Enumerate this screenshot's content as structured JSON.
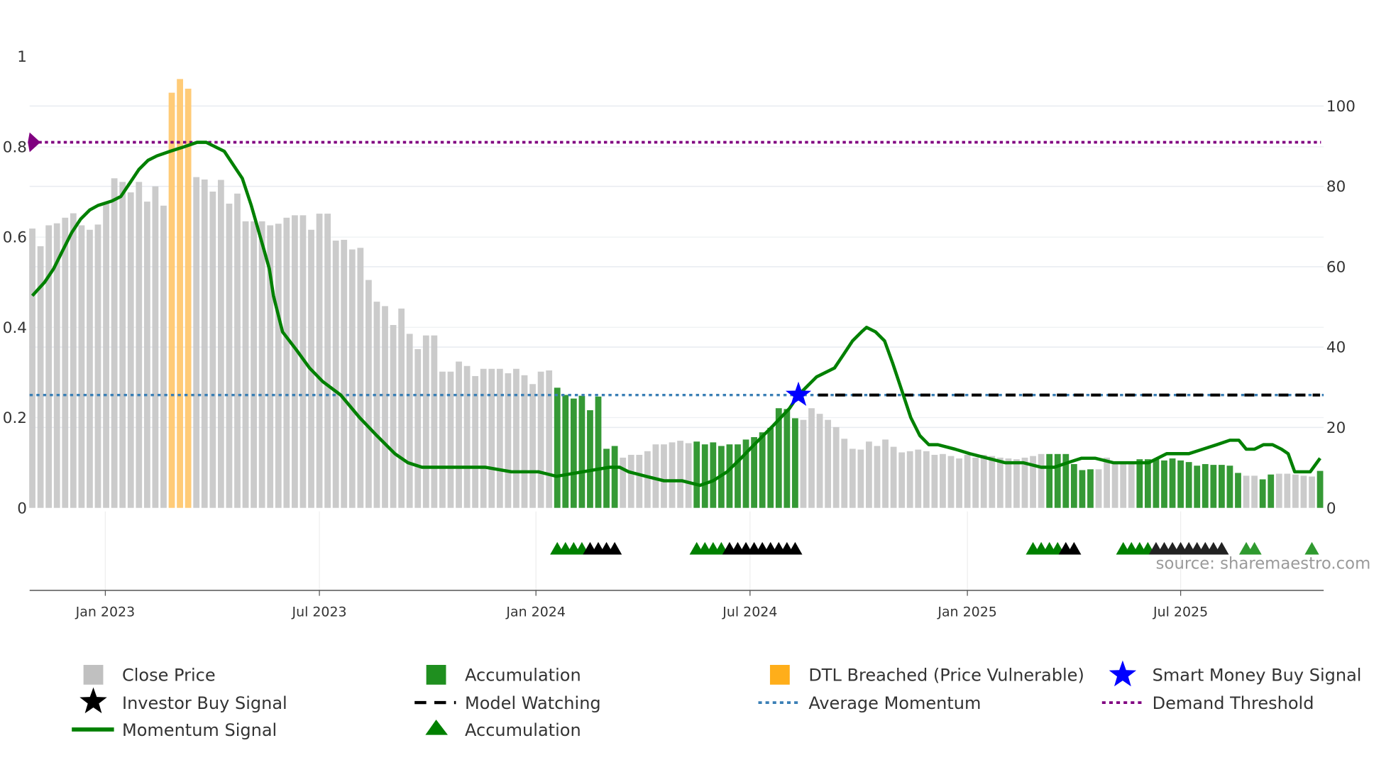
{
  "colors": {
    "close_price": "#c8c8c8",
    "accumulation": "#2a932a",
    "dtl_breached": "#ffc870",
    "dtl_legend": "#ffae1a",
    "momentum": "#008000",
    "average_momentum": "#3a7fb5",
    "demand_threshold": "#800080",
    "model_watching": "#000000",
    "smart_money": "#0000ff",
    "investor_buy": "#000000"
  },
  "source": "source: sharemaestro.com",
  "chart_data": {
    "type": "bar",
    "title": "",
    "xlabel": "",
    "ylabel_left": "",
    "ylabel_right": "",
    "x_unit": "week index",
    "ylim_left": [
      0,
      1
    ],
    "ylim_right": [
      0,
      112.3
    ],
    "left_ticks": [
      "0",
      "0.2",
      "0.4",
      "0.6",
      "0.8",
      "1"
    ],
    "left_tick_values": [
      0,
      0.2,
      0.4,
      0.6,
      0.8,
      1
    ],
    "right_ticks": [
      "0",
      "20",
      "40",
      "60",
      "80",
      "100"
    ],
    "right_tick_values": [
      0,
      20,
      40,
      60,
      80,
      100
    ],
    "x_ticks": [
      {
        "label": "Jan 2023",
        "x": 8.9
      },
      {
        "label": "Jul 2023",
        "x": 35.0
      },
      {
        "label": "Jan 2024",
        "x": 61.4
      },
      {
        "label": "Jul 2024",
        "x": 87.5
      },
      {
        "label": "Jan 2025",
        "x": 114.0
      },
      {
        "label": "Jul 2025",
        "x": 140.0
      }
    ],
    "close_price": [
      69.5,
      65.1,
      70.3,
      70.8,
      72.2,
      73.3,
      70.3,
      69.2,
      70.5,
      76,
      82,
      81.1,
      78.5,
      81.1,
      76.2,
      80,
      75.2,
      103.3,
      106.7,
      104.3,
      82.3,
      81.7,
      78.7,
      81.6,
      75.7,
      78.2,
      71.3,
      71.3,
      71.3,
      70.3,
      70.7,
      72.2,
      72.8,
      72.8,
      69.2,
      73.2,
      73.2,
      66.5,
      66.7,
      64.3,
      64.7,
      56.7,
      51.3,
      50.2,
      45.5,
      49.6,
      43.3,
      39.5,
      42.9,
      42.9,
      33.9,
      33.9,
      36.4,
      35.3,
      32.8,
      34.6,
      34.6,
      34.6,
      33.5,
      34.6,
      33,
      30.8,
      33.9,
      34.2,
      29.9,
      28.1,
      27.2,
      27.9,
      24.3,
      27.7,
      14.7,
      15.4,
      12.5,
      13.2,
      13.2,
      14.1,
      15.8,
      15.8,
      16.3,
      16.7,
      16.1,
      16.5,
      15.8,
      16.3,
      15.4,
      15.8,
      15.8,
      17,
      17.6,
      18.8,
      19.9,
      24.8,
      24.6,
      22.3,
      21.9,
      24.8,
      23.4,
      21.9,
      20.1,
      17.2,
      14.7,
      14.5,
      16.5,
      15.4,
      17,
      15.2,
      13.8,
      14.1,
      14.5,
      14.1,
      13.2,
      13.4,
      12.9,
      12.3,
      13.2,
      12.5,
      13.2,
      12.9,
      12.5,
      12.3,
      12.1,
      12.5,
      12.9,
      13.4,
      13.4,
      13.4,
      13.4,
      10.9,
      9.4,
      9.6,
      9.6,
      12.5,
      11.6,
      11.2,
      10.9,
      12.1,
      12.1,
      12.1,
      11.8,
      12.3,
      11.8,
      11.4,
      10.5,
      10.9,
      10.7,
      10.7,
      10.5,
      8.7,
      8,
      8,
      7.1,
      8.3,
      8.5,
      8.5,
      8.3,
      8,
      7.8,
      9.2
    ],
    "bar_state": "ggggggggggggggggg",
    "bar_state_runs": [
      [
        "g",
        17
      ],
      [
        "o",
        3
      ],
      [
        "g",
        44
      ],
      [
        "a",
        8
      ],
      [
        "g",
        9
      ],
      [
        "a",
        13
      ],
      [
        "g",
        30
      ],
      [
        "a",
        6
      ],
      [
        "g",
        5
      ],
      [
        "a",
        13
      ],
      [
        "g",
        2
      ],
      [
        "a",
        2
      ],
      [
        "g",
        5
      ],
      [
        "a",
        1
      ]
    ],
    "momentum": [
      [
        0,
        0.47
      ],
      [
        1.5,
        0.5
      ],
      [
        2.6,
        0.53
      ],
      [
        3.7,
        0.57
      ],
      [
        4.8,
        0.61
      ],
      [
        5.9,
        0.64
      ],
      [
        7.0,
        0.66
      ],
      [
        8.0,
        0.67
      ],
      [
        9.7,
        0.68
      ],
      [
        10.8,
        0.69
      ],
      [
        11.9,
        0.72
      ],
      [
        13.0,
        0.75
      ],
      [
        14.1,
        0.77
      ],
      [
        15.2,
        0.78
      ],
      [
        16.8,
        0.79
      ],
      [
        18.5,
        0.8
      ],
      [
        20.1,
        0.81
      ],
      [
        21.2,
        0.81
      ],
      [
        22.3,
        0.8
      ],
      [
        23.4,
        0.79
      ],
      [
        24.5,
        0.76
      ],
      [
        25.6,
        0.73
      ],
      [
        26.7,
        0.67
      ],
      [
        27.8,
        0.6
      ],
      [
        28.9,
        0.53
      ],
      [
        29.4,
        0.47
      ],
      [
        30.5,
        0.39
      ],
      [
        32.2,
        0.35
      ],
      [
        33.8,
        0.31
      ],
      [
        35.4,
        0.28
      ],
      [
        37.6,
        0.25
      ],
      [
        39.9,
        0.2
      ],
      [
        42.0,
        0.16
      ],
      [
        44.2,
        0.12
      ],
      [
        45.8,
        0.1
      ],
      [
        47.5,
        0.09
      ],
      [
        50.7,
        0.09
      ],
      [
        55.2,
        0.09
      ],
      [
        58.4,
        0.08
      ],
      [
        61.7,
        0.08
      ],
      [
        63.9,
        0.07
      ],
      [
        67.1,
        0.08
      ],
      [
        70.4,
        0.09
      ],
      [
        71.6,
        0.09
      ],
      [
        72.7,
        0.08
      ],
      [
        74.8,
        0.07
      ],
      [
        77.0,
        0.06
      ],
      [
        79.2,
        0.06
      ],
      [
        81.4,
        0.05
      ],
      [
        83.0,
        0.06
      ],
      [
        84.7,
        0.08
      ],
      [
        86.4,
        0.11
      ],
      [
        88.0,
        0.14
      ],
      [
        90.2,
        0.18
      ],
      [
        92.3,
        0.22
      ],
      [
        93.4,
        0.25
      ],
      [
        94.5,
        0.27
      ],
      [
        95.6,
        0.29
      ],
      [
        97.8,
        0.31
      ],
      [
        98.9,
        0.34
      ],
      [
        100.0,
        0.37
      ],
      [
        101.1,
        0.39
      ],
      [
        101.7,
        0.4
      ],
      [
        102.8,
        0.39
      ],
      [
        103.9,
        0.37
      ],
      [
        104.9,
        0.32
      ],
      [
        106.0,
        0.26
      ],
      [
        107.1,
        0.2
      ],
      [
        108.2,
        0.16
      ],
      [
        109.3,
        0.14
      ],
      [
        110.4,
        0.14
      ],
      [
        112.5,
        0.13
      ],
      [
        114.3,
        0.12
      ],
      [
        116.5,
        0.11
      ],
      [
        118.6,
        0.1
      ],
      [
        120.8,
        0.1
      ],
      [
        123.0,
        0.09
      ],
      [
        124.6,
        0.09
      ],
      [
        126.2,
        0.1
      ],
      [
        127.9,
        0.11
      ],
      [
        129.6,
        0.11
      ],
      [
        131.8,
        0.1
      ],
      [
        133.9,
        0.1
      ],
      [
        136.1,
        0.1
      ],
      [
        138.3,
        0.12
      ],
      [
        141.0,
        0.12
      ],
      [
        142.7,
        0.13
      ],
      [
        144.4,
        0.14
      ],
      [
        146.0,
        0.15
      ],
      [
        147.1,
        0.15
      ],
      [
        148.0,
        0.13
      ],
      [
        149.0,
        0.13
      ],
      [
        150.1,
        0.14
      ],
      [
        151.2,
        0.14
      ],
      [
        152.3,
        0.13
      ],
      [
        153.1,
        0.12
      ],
      [
        153.9,
        0.08
      ],
      [
        154.7,
        0.08
      ],
      [
        155.8,
        0.08
      ],
      [
        157,
        0.11
      ]
    ],
    "average_momentum": 0.25,
    "demand_threshold": 0.81,
    "model_watching": {
      "from": 93.4,
      "to": 157,
      "value": 0.25
    },
    "smart_money_buy": [
      {
        "x": 93.4,
        "y": 0.25
      }
    ],
    "accumulation_markers": [
      64,
      65,
      66,
      67,
      81,
      82,
      83,
      84,
      122,
      123,
      124,
      125,
      133,
      134,
      135,
      136,
      148,
      149,
      156
    ],
    "investor_buy_markers": [
      68,
      69,
      70,
      71,
      85,
      86,
      87,
      88,
      89,
      90,
      91,
      92,
      93,
      126,
      127,
      137,
      138,
      139,
      140,
      141,
      142,
      143,
      144,
      145
    ],
    "legend": [
      {
        "label": "Close Price",
        "icon": "gray-square"
      },
      {
        "label": "Accumulation",
        "icon": "green-square"
      },
      {
        "label": "DTL Breached (Price Vulnerable)",
        "icon": "orange-square"
      },
      {
        "label": "Smart Money Buy Signal",
        "icon": "blue-star"
      },
      {
        "label": "Investor Buy Signal",
        "icon": "black-star"
      },
      {
        "label": "Model Watching",
        "icon": "black-dashed-line"
      },
      {
        "label": "Average Momentum",
        "icon": "blue-dotted-line"
      },
      {
        "label": "Demand Threshold",
        "icon": "purple-dotted-line"
      },
      {
        "label": "Momentum Signal",
        "icon": "green-line"
      },
      {
        "label": "Accumulation",
        "icon": "green-triangle"
      }
    ],
    "legend_placement": "bottom"
  }
}
